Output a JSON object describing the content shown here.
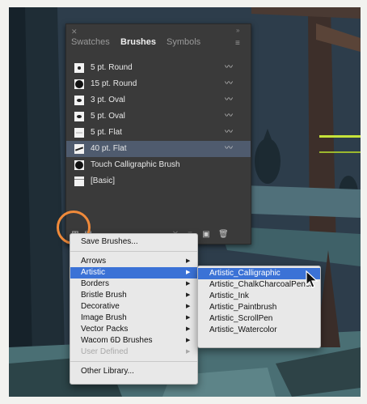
{
  "panel": {
    "tabs": [
      {
        "label": "Swatches",
        "active": false
      },
      {
        "label": "Brushes",
        "active": true
      },
      {
        "label": "Symbols",
        "active": false
      }
    ],
    "close_icon": "close-icon",
    "menu_icon": "panel-menu-icon"
  },
  "brushes": [
    {
      "name": "5 pt. Round",
      "swatch": "round-small"
    },
    {
      "name": "15 pt. Round",
      "swatch": "round-large"
    },
    {
      "name": "3 pt. Oval",
      "swatch": "oval"
    },
    {
      "name": "5 pt. Oval",
      "swatch": "oval"
    },
    {
      "name": "5 pt. Flat",
      "swatch": "flat"
    },
    {
      "name": "40 pt. Flat",
      "swatch": "flat-slant",
      "selected": true
    },
    {
      "name": "Touch Calligraphic Brush",
      "swatch": "round-large"
    },
    {
      "name": "[Basic]",
      "swatch": "basic"
    }
  ],
  "libraries_menu": {
    "items": [
      {
        "label": "Save Brushes...",
        "submenu": false
      },
      {
        "label": "Arrows",
        "submenu": true
      },
      {
        "label": "Artistic",
        "submenu": true,
        "active": true
      },
      {
        "label": "Borders",
        "submenu": true
      },
      {
        "label": "Bristle Brush",
        "submenu": true
      },
      {
        "label": "Decorative",
        "submenu": true
      },
      {
        "label": "Image Brush",
        "submenu": true
      },
      {
        "label": "Vector Packs",
        "submenu": true
      },
      {
        "label": "Wacom 6D Brushes",
        "submenu": true
      },
      {
        "label": "User Defined",
        "submenu": true,
        "disabled": true
      },
      {
        "label": "Other Library...",
        "submenu": false
      }
    ]
  },
  "artistic_submenu": {
    "items": [
      {
        "label": "Artistic_Calligraphic",
        "active": true
      },
      {
        "label": "Artistic_ChalkCharcoalPencil"
      },
      {
        "label": "Artistic_Ink"
      },
      {
        "label": "Artistic_Paintbrush"
      },
      {
        "label": "Artistic_ScrollPen"
      },
      {
        "label": "Artistic_Watercolor"
      }
    ]
  },
  "colors": {
    "highlight_ring": "#f08a3a",
    "menu_selection": "#3b72d6",
    "selected_row": "#4f5b6e"
  }
}
